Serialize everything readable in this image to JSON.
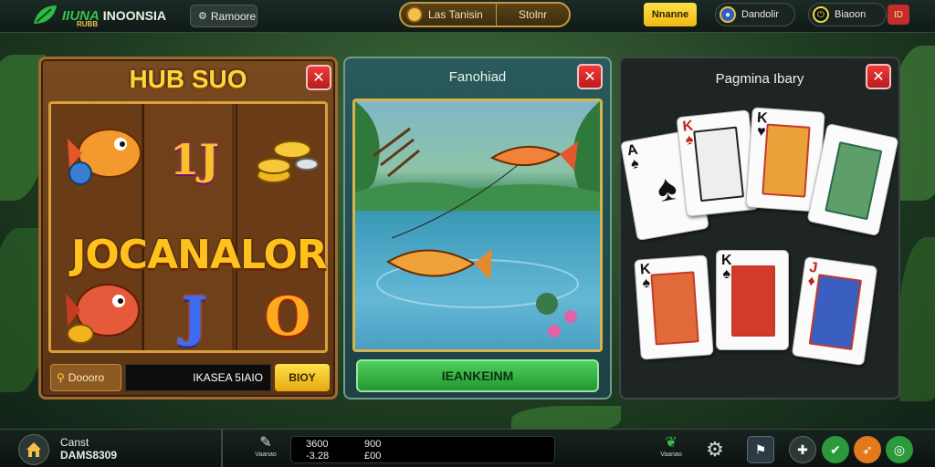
{
  "topbar": {
    "logo_brand": "IIUNA",
    "logo_name": "INOONSIA",
    "logo_sub": "RUBB",
    "language_label": "Ramoore",
    "center_left_label": "Las Tanisin",
    "center_right_label": "Stolnr",
    "yellow_button_label": "Nnanne",
    "pill1_label": "Dandolir",
    "pill2_label": "Biaoon",
    "flag_label": "ID"
  },
  "panels": {
    "slot": {
      "title": "HUB SUO",
      "top_symbol": "1J",
      "jackpot_text": "JOCANALOR",
      "bottom_symbol_1": "J",
      "bottom_symbol_2": "O",
      "key_label": "Doooro",
      "amount": "IKASEA 5IAIO",
      "play_label": "BIOY"
    },
    "fishing": {
      "title": "Fanohiad",
      "button_label": "IEANKEINM"
    },
    "cards": {
      "title": "Pagmina Ibary",
      "cards_top": [
        {
          "rank": "A",
          "suit": "♠",
          "color": "#111"
        },
        {
          "rank": "K",
          "suit": "♠",
          "color": "#c0281c"
        },
        {
          "rank": "K",
          "suit": "♥",
          "color": "#111"
        },
        {
          "rank": "",
          "suit": "",
          "color": "#111"
        }
      ],
      "cards_bottom": [
        {
          "rank": "K",
          "suit": "♠",
          "color": "#111"
        },
        {
          "rank": "K",
          "suit": "♠",
          "color": "#111"
        },
        {
          "rank": "J",
          "suit": "♦",
          "color": "#c0281c"
        }
      ]
    }
  },
  "bottombar": {
    "account_name": "Canst",
    "account_id": "DAMS8309",
    "stats_icon_label": "Vaanao",
    "stats": {
      "row1_col1": "3600",
      "row1_col2": "900",
      "row2_col1": "-3.28",
      "row2_col2": "£00"
    },
    "right_icon_label": "Vaanao"
  },
  "colors": {
    "accent_gold": "#ffd43a",
    "accent_green": "#35c14b",
    "close_red": "#d62a2a"
  }
}
